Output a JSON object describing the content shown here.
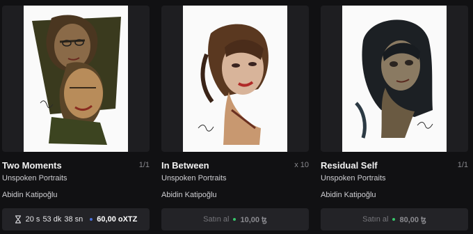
{
  "cards": [
    {
      "title": "Two Moments",
      "edition": "1/1",
      "collection": "Unspoken Portraits",
      "artist": "Abidin Katipoğlu",
      "action": {
        "icon": "hourglass-icon",
        "countdown_days": "20 s",
        "countdown_minutes": "53 dk",
        "countdown_seconds": "38 sn",
        "price": "60,00 oXTZ"
      }
    },
    {
      "title": "In Between",
      "edition": "x 10",
      "collection": "Unspoken Portraits",
      "artist": "Abidin Katipoğlu",
      "action": {
        "label": "Satın al",
        "price": "10,00 ꜩ"
      }
    },
    {
      "title": "Residual Self",
      "edition": "1/1",
      "collection": "Unspoken Portraits",
      "artist": "Abidin Katipoğlu",
      "action": {
        "label": "Satın al",
        "price": "80,00 ꜩ"
      }
    }
  ],
  "colors": {
    "background": "#111113",
    "card_thumb": "#1e1e21",
    "button": "#232327",
    "status_dot": "#37c56a"
  }
}
